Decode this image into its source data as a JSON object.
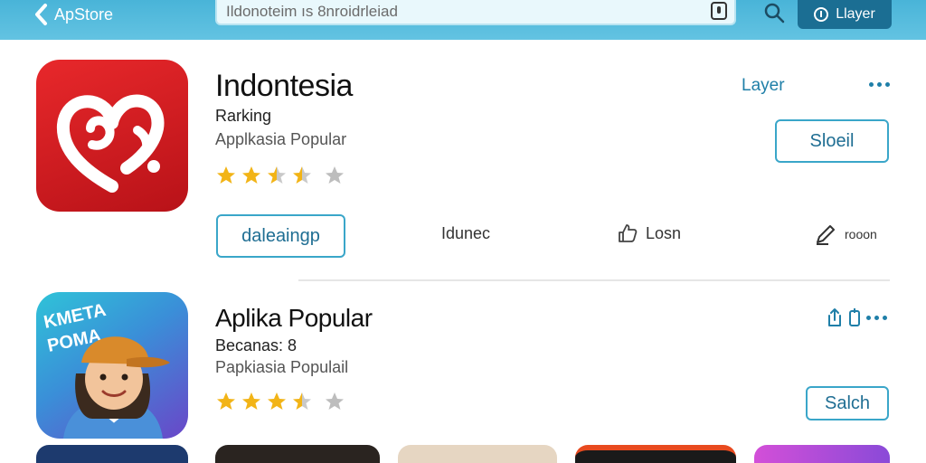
{
  "topbar": {
    "back_label": "ApStore",
    "search_placeholder": "Ildonoteim ıs 8nroidrleiad",
    "action_button_label": "Llayer"
  },
  "apps": [
    {
      "title": "Indontesia",
      "subtitle": "Rarking",
      "category": "Applkasia Popular",
      "rating": 3.5,
      "side_link": "Layer",
      "primary_button": "Sloeil",
      "secondary_button": "daleaingp",
      "actions": [
        {
          "label": "Idunec"
        },
        {
          "label": "Losn"
        },
        {
          "label": "rooon"
        }
      ]
    },
    {
      "title": "Aplika Popular",
      "subtitle": "Becanas: 8",
      "category": "Papkiasia Populail",
      "rating": 3.5,
      "icon_caption_line1": "KMETA",
      "icon_caption_line2": "POMA",
      "primary_button": "Salch"
    }
  ],
  "colors": {
    "topbar": "#49b4d8",
    "accent": "#1f7fa8",
    "star": "#f2b417",
    "app1_icon": "#d71e24"
  }
}
